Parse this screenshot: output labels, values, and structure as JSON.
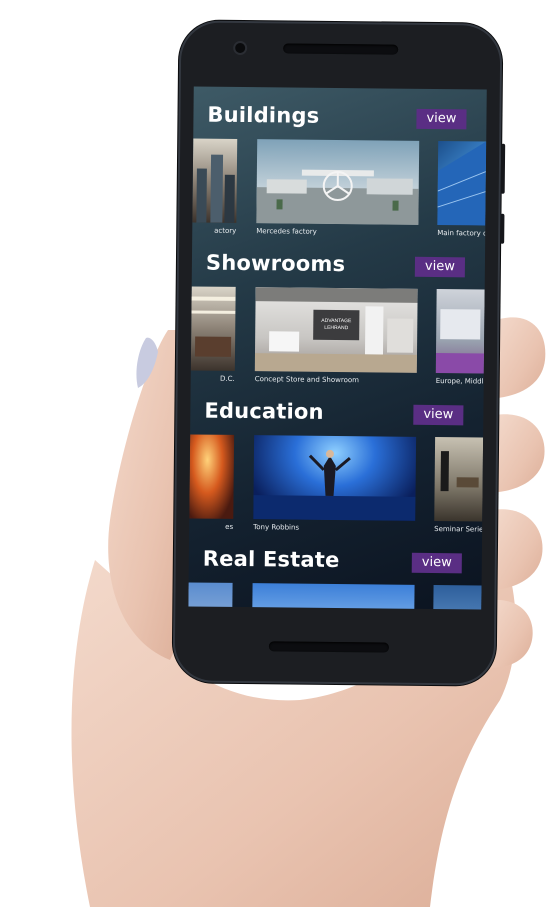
{
  "screen": {
    "sections": [
      {
        "title": "Buildings",
        "view_label": "view",
        "captions": [
          "actory",
          "Mercedes factory",
          "Main factory of"
        ]
      },
      {
        "title": "Showrooms",
        "view_label": "view",
        "captions": [
          "D.C.",
          "Concept Store and Showroom",
          "Europe, Middle"
        ],
        "signage": [
          "ADVANTAGE",
          "LEHRAND"
        ]
      },
      {
        "title": "Education",
        "view_label": "view",
        "captions": [
          "es",
          "Tony Robbins",
          "Seminar Series"
        ]
      },
      {
        "title": "Real Estate",
        "view_label": "view"
      }
    ]
  },
  "colors": {
    "view_button": "#5a2e84",
    "screen_top": "#3e5a66",
    "screen_bottom": "#0b1320"
  }
}
